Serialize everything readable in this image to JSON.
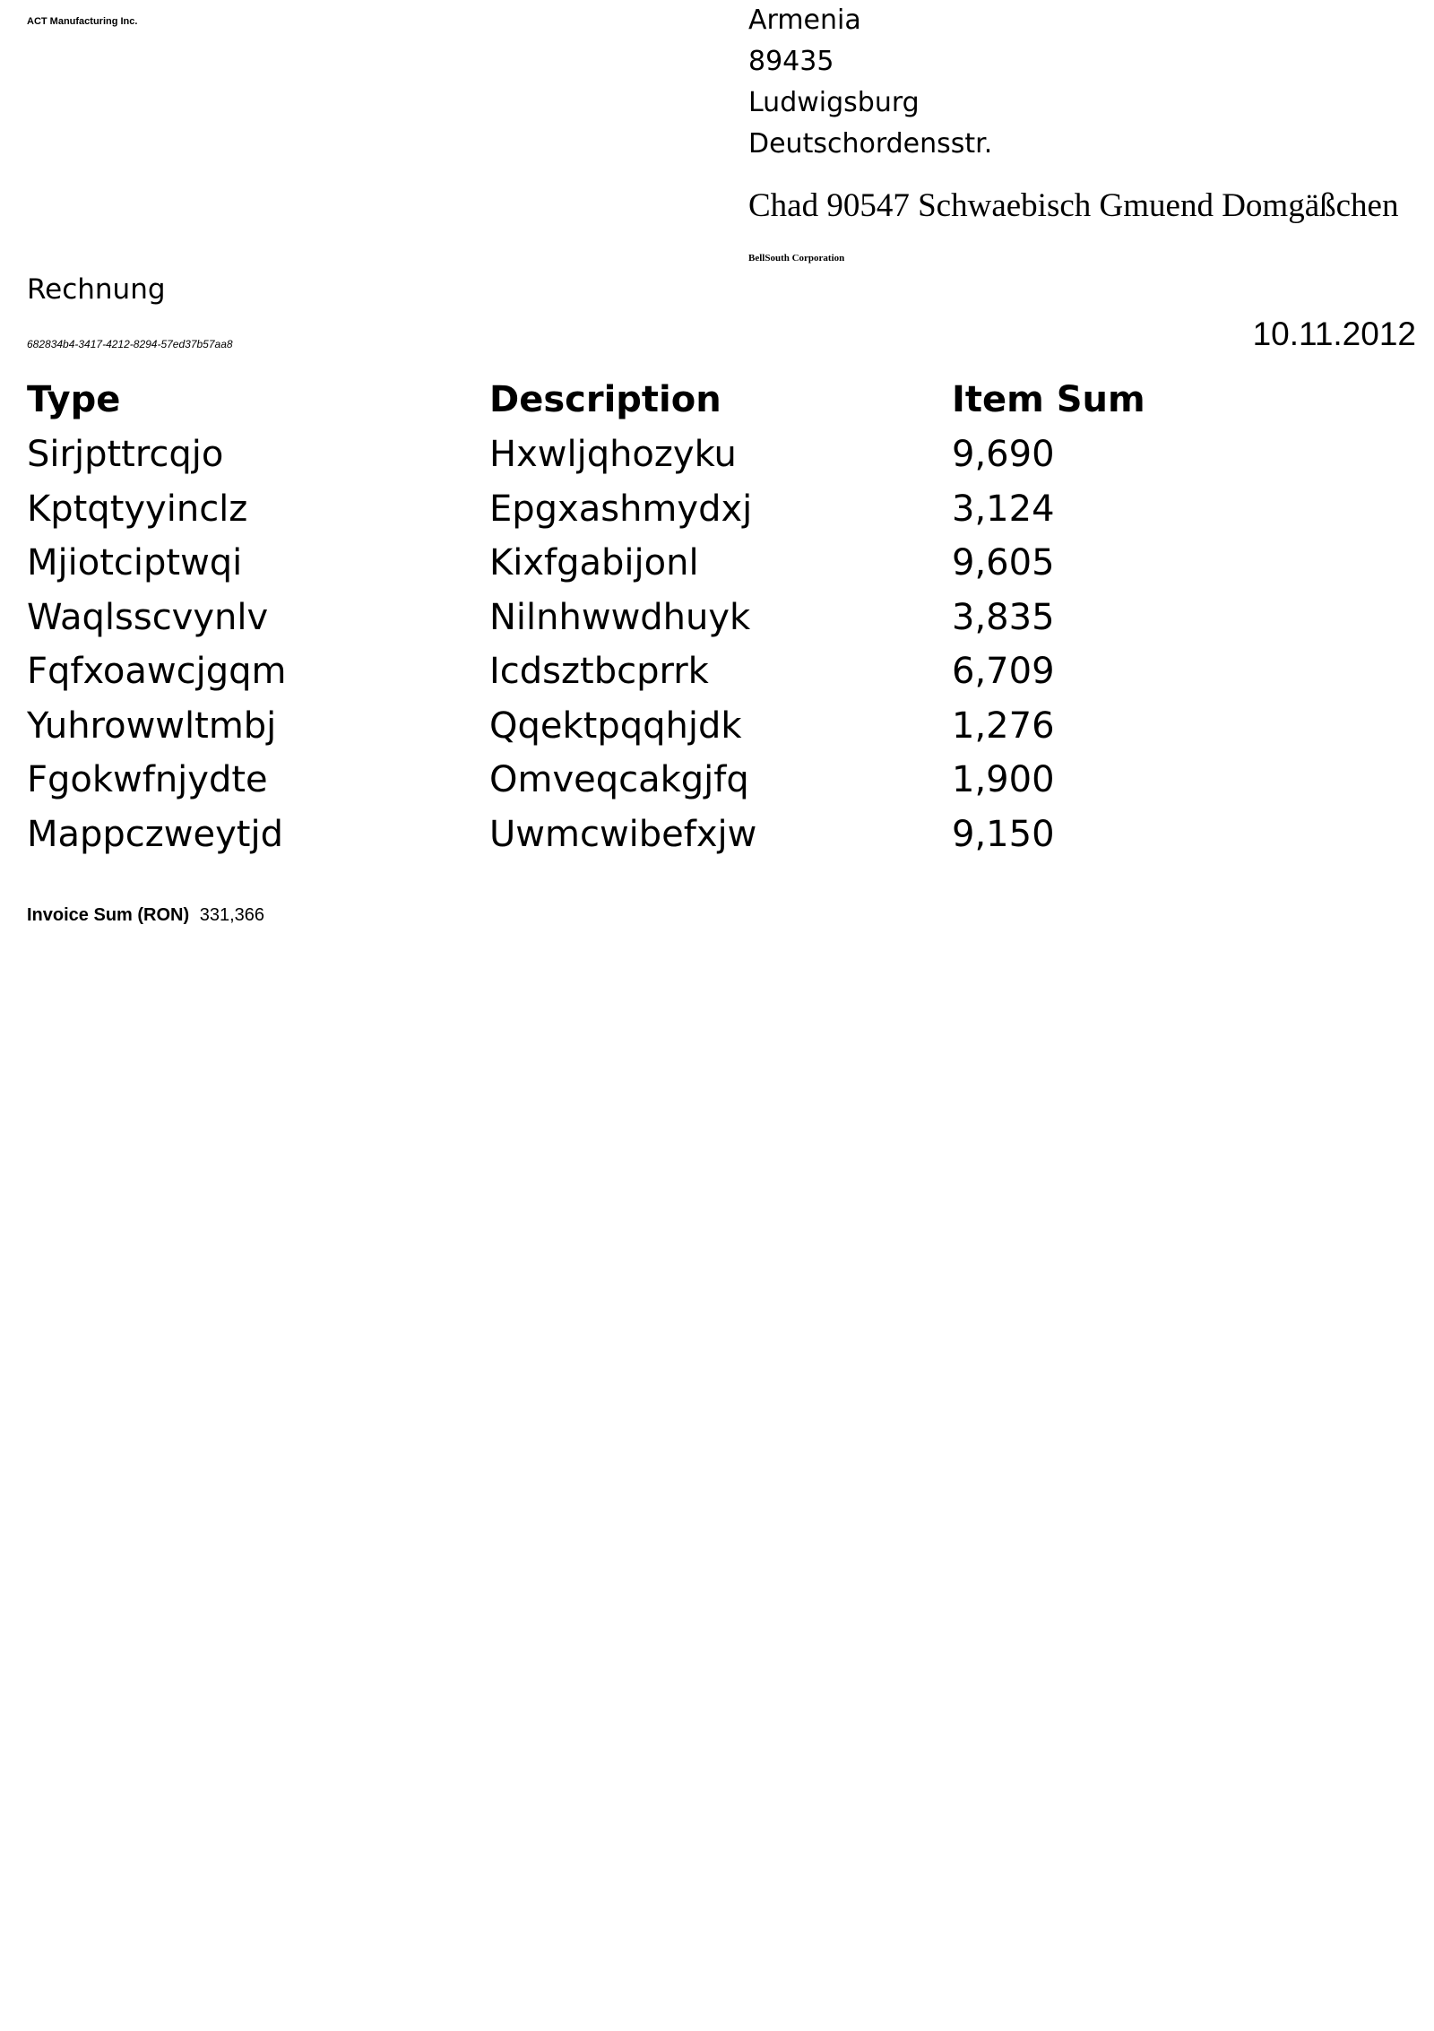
{
  "sender": {
    "company": "ACT Manufacturing Inc.",
    "address_lines": [
      "Armenia",
      "89435",
      "Ludwigsburg",
      "Deutschordensstr."
    ]
  },
  "recipient": {
    "address_line": "Chad 90547 Schwaebisch Gmuend Domgäßchen",
    "company": "BellSouth Corporation"
  },
  "document": {
    "title": "Rechnung",
    "id": "682834b4-3417-4212-8294-57ed37b57aa8",
    "date": "10.11.2012"
  },
  "table": {
    "headers": [
      "Type",
      "Description",
      "Item Sum"
    ],
    "rows": [
      [
        "Sirjpttrcqjo",
        "Hxwljqhozyku",
        "9,690"
      ],
      [
        "Kptqtyyinclz",
        "Epgxashmydxj",
        "3,124"
      ],
      [
        "Mjiotciptwqi",
        "Kixfgabijonl",
        "9,605"
      ],
      [
        "Waqlsscvynlv",
        "Nilnhwwdhuyk",
        "3,835"
      ],
      [
        "Fqfxoawcjgqm",
        "Icdsztbcprrk",
        "6,709"
      ],
      [
        "Yuhrowwltmbj",
        "Qqektpqqhjdk",
        "1,276"
      ],
      [
        "Fgokwfnjydte",
        "Omveqcakgjfq",
        "1,900"
      ],
      [
        "Mappczweytjd",
        "Uwmcwibefxjw",
        "9,150"
      ]
    ]
  },
  "summary": {
    "label": "Invoice Sum (RON)",
    "value": "331,366"
  }
}
